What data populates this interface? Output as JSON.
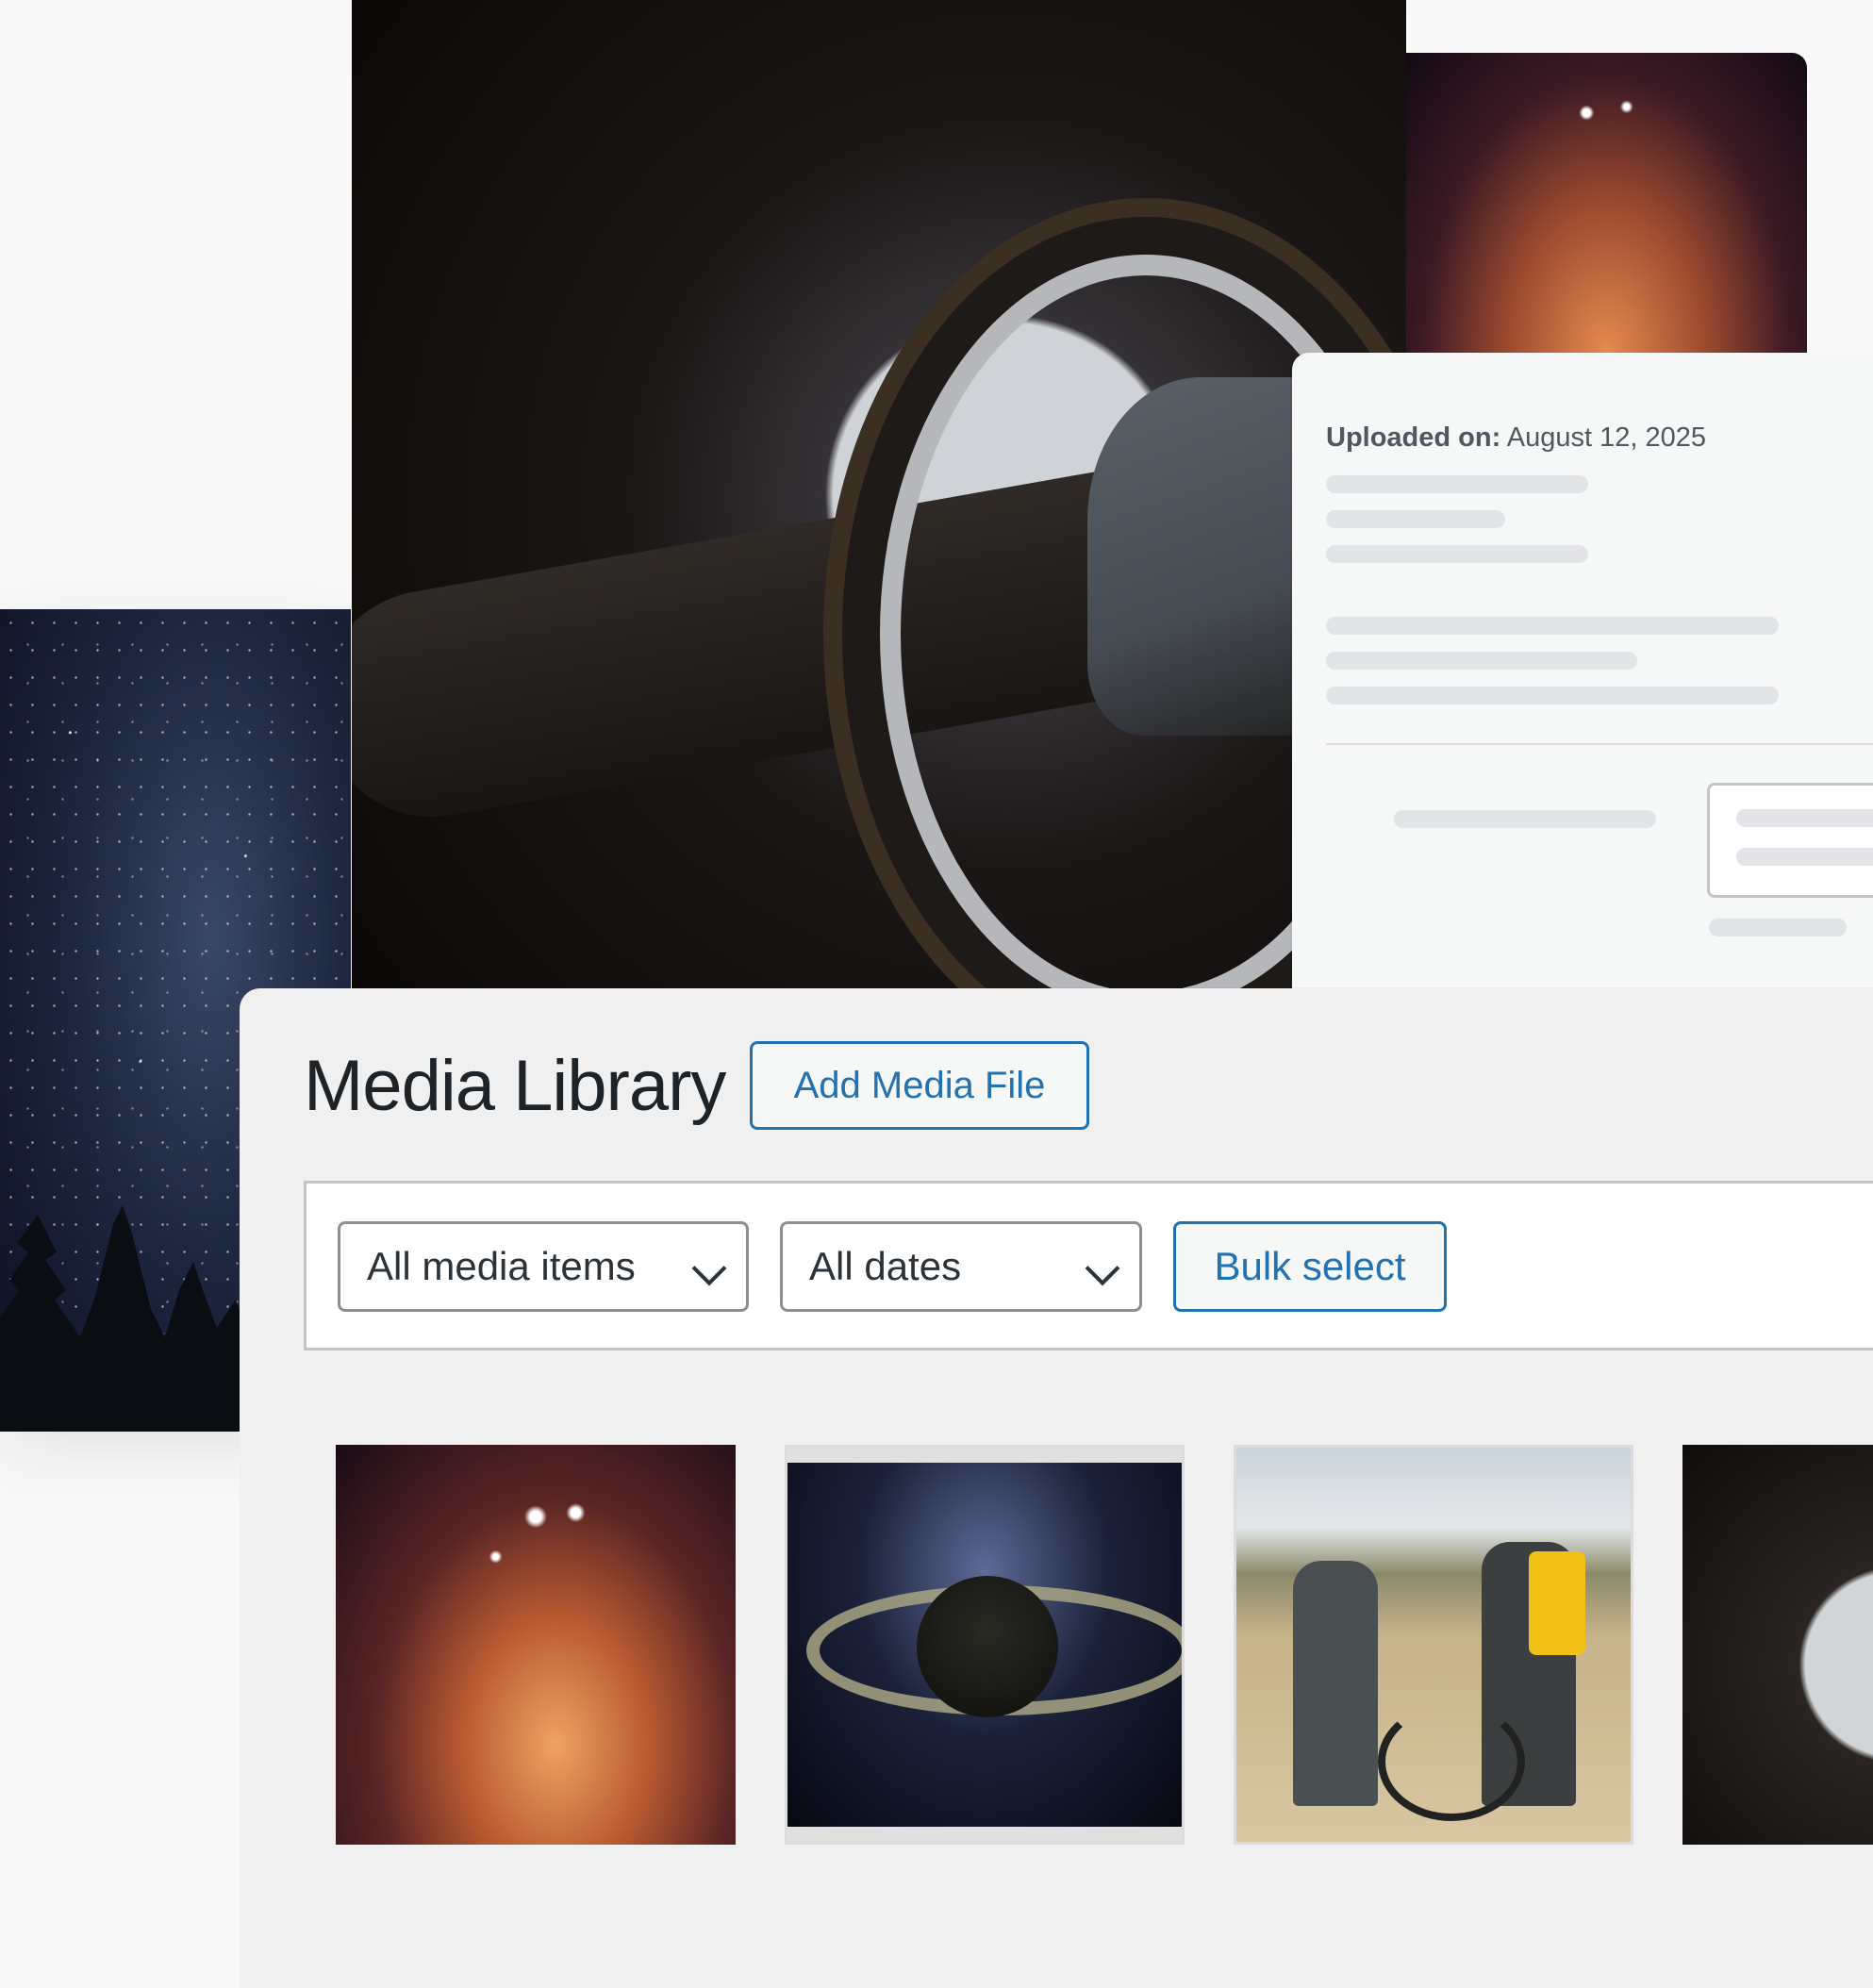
{
  "detail": {
    "uploaded_label": "Uploaded on:",
    "uploaded_date": "August 12, 2025"
  },
  "library": {
    "title": "Media Library",
    "add_button": "Add Media File",
    "filters": {
      "type_selected": "All media items",
      "date_selected": "All dates"
    },
    "bulk_button": "Bulk select",
    "thumbnails": [
      {
        "subject": "nebula"
      },
      {
        "subject": "saturn"
      },
      {
        "subject": "field-team"
      },
      {
        "subject": "spacecraft"
      }
    ]
  },
  "colors": {
    "accent": "#2271b1",
    "text": "#1d2327",
    "panel_bg": "#f0f0f1"
  }
}
